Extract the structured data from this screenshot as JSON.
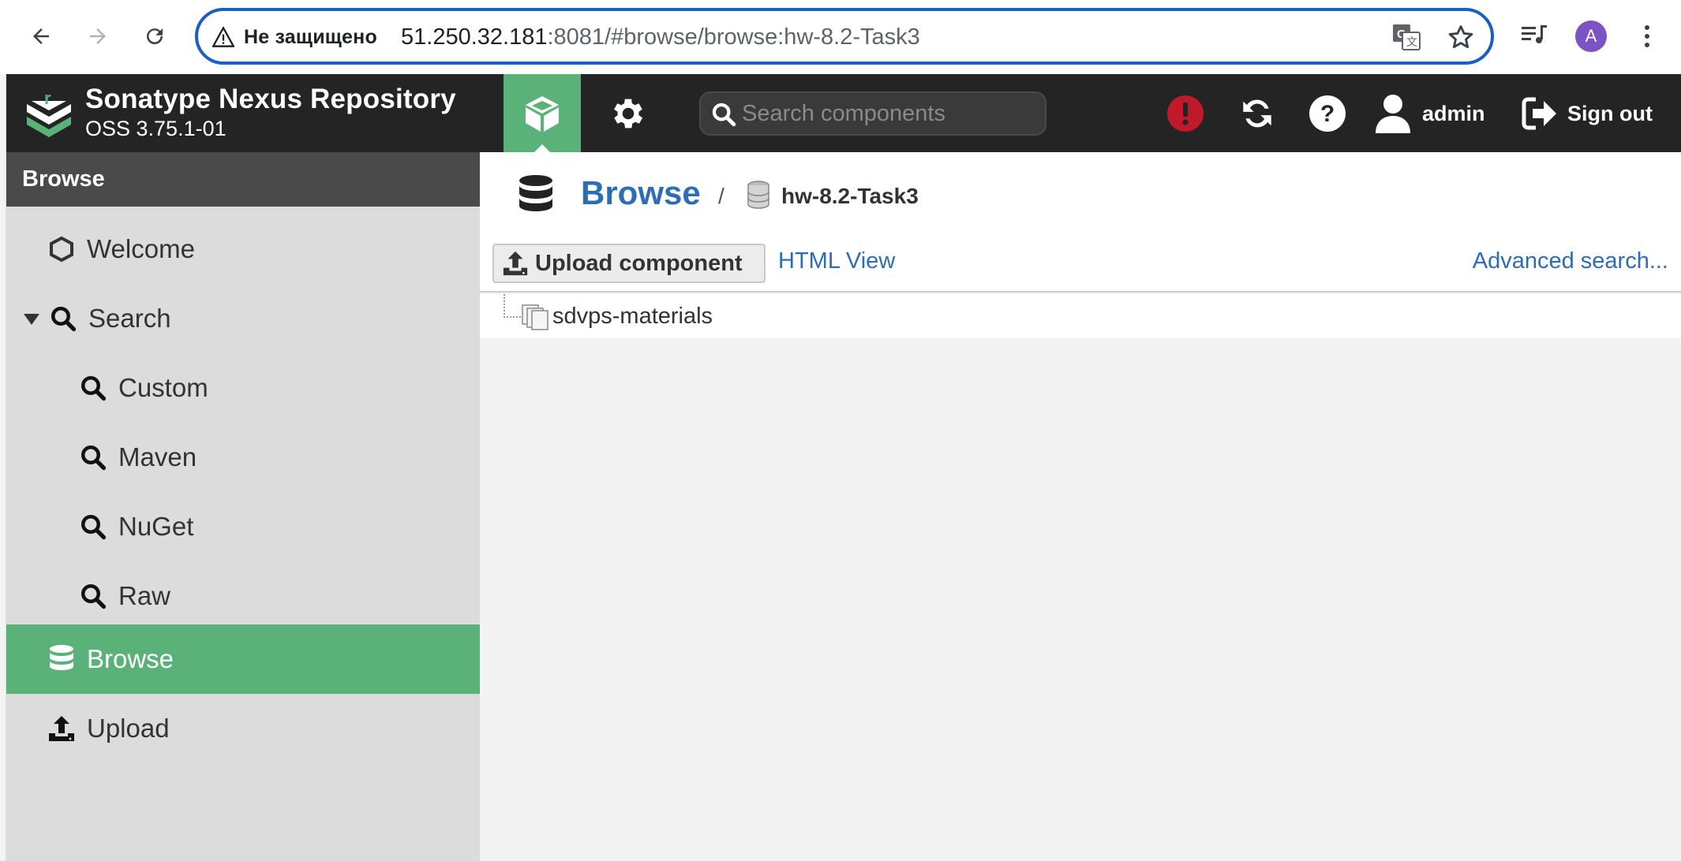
{
  "browser": {
    "security_label": "Не защищено",
    "url_host": "51.250.32.181",
    "url_rest": ":8081/#browse/browse:hw-8.2-Task3",
    "profile_initial": "A",
    "accent": "#1a5fc2"
  },
  "header": {
    "brand_name": "Sonatype Nexus Repository",
    "brand_version": "OSS 3.75.1-01",
    "search_placeholder": "Search components",
    "user_label": "admin",
    "signout_label": "Sign out",
    "icons": [
      "browse-mode-cube-icon",
      "admin-gear-icon",
      "alert-icon",
      "refresh-icon",
      "help-icon",
      "user-icon",
      "sign-out-icon"
    ],
    "colors": {
      "bg": "#242424",
      "active": "#5bb279",
      "alert": "#c0192b"
    }
  },
  "sidebar": {
    "title": "Browse",
    "items": [
      {
        "label": "Welcome",
        "icon": "hexagon-icon"
      },
      {
        "label": "Search",
        "icon": "search-icon",
        "expanded": true
      },
      {
        "label": "Custom",
        "icon": "search-icon"
      },
      {
        "label": "Maven",
        "icon": "search-icon"
      },
      {
        "label": "NuGet",
        "icon": "search-icon"
      },
      {
        "label": "Raw",
        "icon": "search-icon"
      },
      {
        "label": "Browse",
        "icon": "database-icon",
        "active": true
      },
      {
        "label": "Upload",
        "icon": "upload-icon"
      }
    ]
  },
  "main": {
    "breadcrumb_title": "Browse",
    "breadcrumb_sep": "/",
    "breadcrumb_repo": "hw-8.2-Task3",
    "upload_button": "Upload component",
    "html_view": "HTML View",
    "advanced_search": "Advanced search...",
    "tree": [
      {
        "label": "sdvps-materials",
        "icon": "folder-stack-icon"
      }
    ]
  }
}
